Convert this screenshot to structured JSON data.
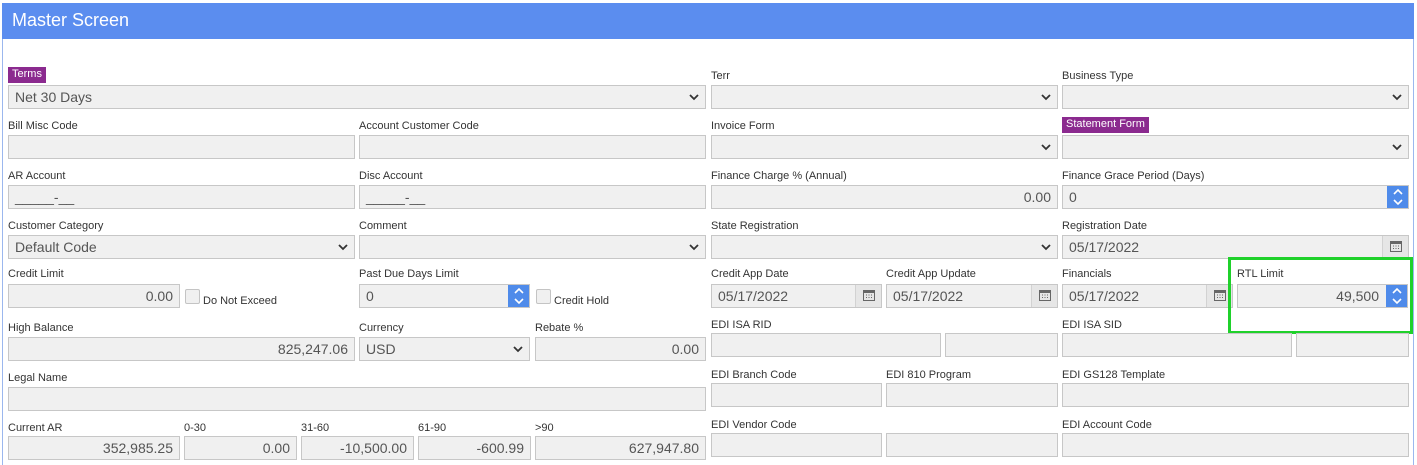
{
  "window": {
    "title": "Master Screen"
  },
  "icons": {
    "select": "chevron-down-icon",
    "calendar": "calendar-icon",
    "spinner": "up-down-arrows-icon"
  },
  "colors": {
    "title_bar": "#5b8def",
    "required_label": "#8b2a8f",
    "spinner": "#4f8bea",
    "highlight": "#1fd12b"
  },
  "fields": {
    "terms": {
      "label": "Terms",
      "value": "Net 30 Days"
    },
    "terr": {
      "label": "Terr",
      "value": ""
    },
    "business_type": {
      "label": "Business Type",
      "value": ""
    },
    "bill_misc_code": {
      "label": "Bill Misc Code",
      "value": ""
    },
    "account_customer_code": {
      "label": "Account Customer Code",
      "value": ""
    },
    "invoice_form": {
      "label": "Invoice Form",
      "value": ""
    },
    "statement_form": {
      "label": "Statement Form",
      "value": ""
    },
    "ar_account": {
      "label": "AR Account",
      "value": "_____-__"
    },
    "disc_account": {
      "label": "Disc Account",
      "value": "_____-__"
    },
    "finance_charge": {
      "label": "Finance Charge % (Annual)",
      "value": "0.00"
    },
    "finance_grace": {
      "label": "Finance Grace Period (Days)",
      "value": "0"
    },
    "customer_category": {
      "label": "Customer Category",
      "value": "Default Code"
    },
    "comment": {
      "label": "Comment",
      "value": ""
    },
    "state_registration": {
      "label": "State Registration",
      "value": ""
    },
    "registration_date": {
      "label": "Registration Date",
      "value": "05/17/2022"
    },
    "credit_limit": {
      "label": "Credit Limit",
      "value": "0.00"
    },
    "do_not_exceed": {
      "label": "Do Not Exceed",
      "checked": false
    },
    "past_due_days_limit": {
      "label": "Past Due Days Limit",
      "value": "0"
    },
    "credit_hold": {
      "label": "Credit Hold",
      "checked": false
    },
    "credit_app_date": {
      "label": "Credit App Date",
      "value": "05/17/2022"
    },
    "credit_app_update": {
      "label": "Credit App Update",
      "value": "05/17/2022"
    },
    "financials": {
      "label": "Financials",
      "value": "05/17/2022"
    },
    "rtl_limit": {
      "label": "RTL Limit",
      "value": "49,500"
    },
    "high_balance": {
      "label": "High Balance",
      "value": "825,247.06"
    },
    "currency": {
      "label": "Currency",
      "value": "USD"
    },
    "rebate": {
      "label": "Rebate %",
      "value": "0.00"
    },
    "edi_isa_rid": {
      "label": "EDI ISA RID",
      "value": "",
      "value2": ""
    },
    "edi_isa_sid": {
      "label": "EDI ISA SID",
      "value": "",
      "value2": ""
    },
    "legal_name": {
      "label": "Legal Name",
      "value": ""
    },
    "edi_branch_code": {
      "label": "EDI Branch Code",
      "value": ""
    },
    "edi_810_program": {
      "label": "EDI 810 Program",
      "value": ""
    },
    "edi_gs128_template": {
      "label": "EDI GS128 Template",
      "value": ""
    },
    "current_ar": {
      "label": "Current AR",
      "value": "352,985.25"
    },
    "aging_0_30": {
      "label": "0-30",
      "value": "0.00"
    },
    "aging_31_60": {
      "label": "31-60",
      "value": "-10,500.00"
    },
    "aging_61_90": {
      "label": "61-90",
      "value": "-600.99"
    },
    "aging_over_90": {
      "label": ">90",
      "value": "627,947.80"
    },
    "edi_vendor_code": {
      "label": "EDI Vendor Code",
      "value": "",
      "value2": ""
    },
    "edi_account_code": {
      "label": "EDI Account Code",
      "value": ""
    }
  }
}
